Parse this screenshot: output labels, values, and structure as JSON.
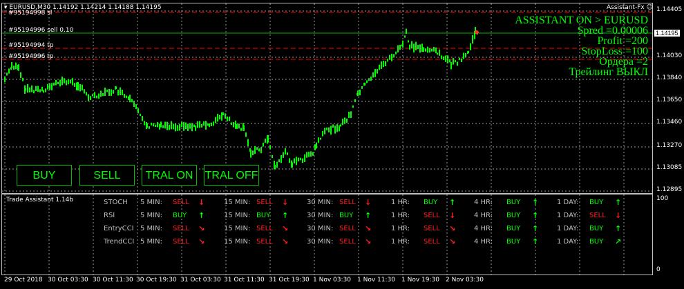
{
  "chart": {
    "symbol_line": "EURUSD,M30  1.14192 1.14214 1.14188 1.14195",
    "ea_name": "Assistant-Fx",
    "order_labels": [
      "#95194998 sl",
      "#95194996 sell 0.10",
      "#95194994 tp",
      "#95194996 tp"
    ],
    "current_price": "1.14195",
    "price_axis": [
      "1.14405",
      "1.14195",
      "1.14030",
      "1.13840",
      "1.13650",
      "1.13460",
      "1.13270",
      "1.13085",
      "1.12895"
    ],
    "sub_axis": [
      "100",
      "0"
    ],
    "time_axis": [
      "29 Oct 2018",
      "30 Oct 03:30",
      "30 Oct 11:30",
      "30 Oct 19:30",
      "31 Oct 03:30",
      "31 Oct 11:30",
      "31 Oct 19:30",
      "1 Nov 03:30",
      "1 Nov 11:30",
      "1 Nov 19:30",
      "2 Nov 03:30"
    ],
    "colors": {
      "bull": "#00ff00",
      "sl_line": "#ff0000",
      "order_line": "#00c000"
    }
  },
  "hud": {
    "line1": "ASSISTANT ON  > EURUSD",
    "line2": "Spred =0.00006",
    "line3": "Profit =200",
    "line4": "StopLoss  =100",
    "line5": "Ордера   =2",
    "line6": "Трейлинг ВЫКЛ"
  },
  "buttons": {
    "buy": "BUY",
    "sell": "SELL",
    "tral_on": "TRAL ON",
    "tral_off": "TRAL OFF"
  },
  "panel": {
    "title": "Trade Assistant 1.14b",
    "timeframes": [
      "5 MIN:",
      "15 MIN:",
      "30 MIN:",
      "1 HR:",
      "4 HR:",
      "1 DAY:"
    ],
    "rows": [
      {
        "name": "STOCH",
        "signals": [
          "SELL",
          "SELL",
          "SELL",
          "BUY",
          "BUY",
          "BUY"
        ],
        "arrows": [
          "↓",
          "↓",
          "↓",
          "↑",
          "↑",
          "↑"
        ]
      },
      {
        "name": "RSI",
        "signals": [
          "BUY",
          "BUY",
          "BUY",
          "SELL",
          "BUY",
          "SELL"
        ],
        "arrows": [
          "↑",
          "↑",
          "↑",
          "↓",
          "↑",
          "↓"
        ]
      },
      {
        "name": "EntryCCI",
        "signals": [
          "SELL",
          "SELL",
          "SELL",
          "SELL",
          "BUY",
          "BUY"
        ],
        "arrows": [
          "↘",
          "↘",
          "↘",
          "↘",
          "↑",
          "↑"
        ]
      },
      {
        "name": "TrendCCI",
        "signals": [
          "SELL",
          "SELL",
          "SELL",
          "SELL",
          "BUY",
          "BUY"
        ],
        "arrows": [
          "↘",
          "↘",
          "↘",
          "↘",
          "↑",
          "↗"
        ]
      }
    ]
  }
}
